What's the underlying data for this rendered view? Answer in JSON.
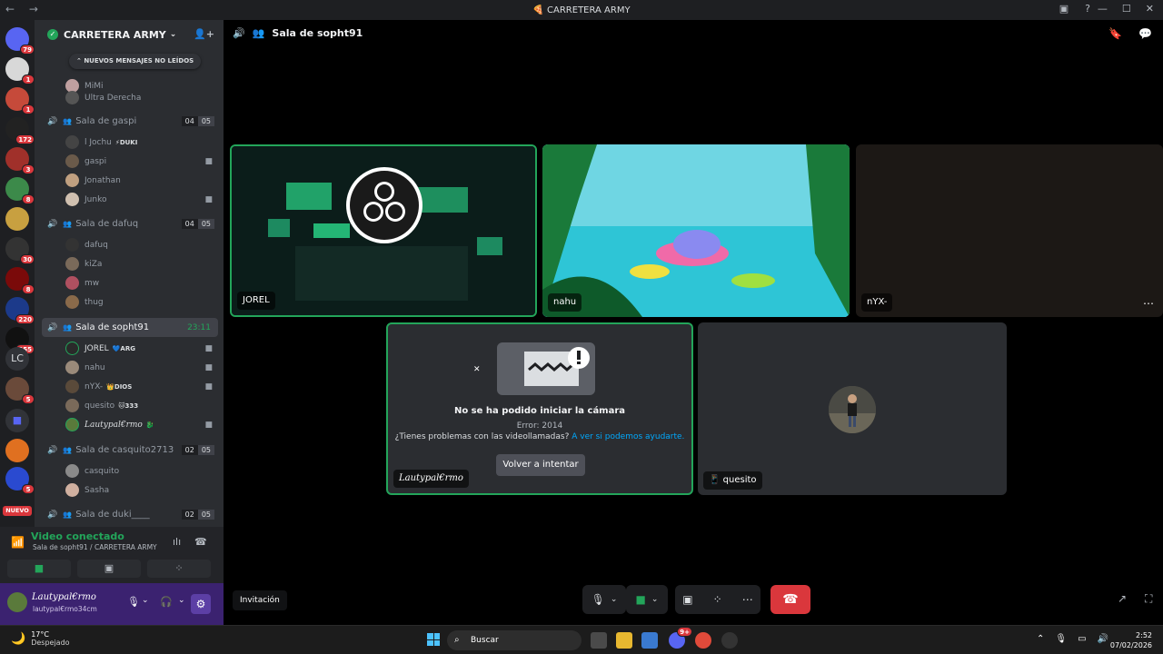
{
  "window": {
    "title": "CARRETERA ARMY",
    "nav": "← →"
  },
  "server_badges": [
    "79",
    "1",
    "1",
    "172",
    "3",
    "8",
    "30",
    "8",
    "220",
    "255",
    "5",
    "5"
  ],
  "server_lc": "LC",
  "server_new": "NUEVO",
  "guild": {
    "name": "CARRETERA ARMY",
    "unread_pill": "NUEVOS MENSAJES NO LEÍDOS",
    "channels": [
      {
        "name": "Sala de gaspi",
        "count_a": "04",
        "count_b": "05",
        "users": [
          {
            "name": "l Jochu",
            "tag": "DUKI"
          },
          {
            "name": "gaspi",
            "tag": ""
          },
          {
            "name": "Jonathan",
            "tag": ""
          },
          {
            "name": "Junko",
            "tag": ""
          }
        ]
      },
      {
        "name": "Sala de dafuq",
        "count_a": "04",
        "count_b": "05",
        "users": [
          {
            "name": "dafuq"
          },
          {
            "name": "kiZa"
          },
          {
            "name": "mw"
          },
          {
            "name": "thug"
          }
        ]
      },
      {
        "name": "Sala de sopht91",
        "time": "23:11",
        "users": [
          {
            "name": "JOREL",
            "tag": "ARG"
          },
          {
            "name": "nahu",
            "tag": ""
          },
          {
            "name": "nYX-",
            "tag": "DIOS"
          },
          {
            "name": "quesito",
            "tag": "333"
          },
          {
            "name": "Lautypal€rmo",
            "tag": ""
          }
        ]
      },
      {
        "name": "Sala de casquito2713",
        "count_a": "02",
        "count_b": "05",
        "users": [
          {
            "name": "casquito"
          },
          {
            "name": "Sasha"
          }
        ]
      },
      {
        "name": "Sala de duki____",
        "count_a": "02",
        "count_b": "05"
      }
    ],
    "top_users": [
      "MiMi",
      "Ultra Derecha"
    ]
  },
  "voice": {
    "status": "Video conectado",
    "location": "Sala de sopht91 / CARRETERA ARMY"
  },
  "me": {
    "name": "Lautypal€rmo",
    "sub": "lautypal€rmo34cm"
  },
  "stage": {
    "room": "Sala de sopht91",
    "tiles": {
      "jorel": "JOREL",
      "nahu": "nahu",
      "nyx": "nYX-",
      "laut": "Lautypal€rmo",
      "quesito": "quesito"
    },
    "camera_error": {
      "title": "No se ha podido iniciar la cámara",
      "code": "Error: 2014",
      "help": "¿Tienes problemas con las videollamadas?",
      "help_link": "A ver si podemos ayudarte.",
      "retry": "Volver a intentar"
    },
    "invite": "Invitación"
  },
  "taskbar": {
    "temp": "17°C",
    "weather": "Despejado",
    "search": "Buscar",
    "time": "2:52",
    "date": "07/02/2026",
    "discord_badge": "9+"
  },
  "colors": {
    "accent_green": "#23a55a",
    "danger": "#da373c",
    "channel_bg": "#2b2d31",
    "userbar": "#3b2270"
  }
}
